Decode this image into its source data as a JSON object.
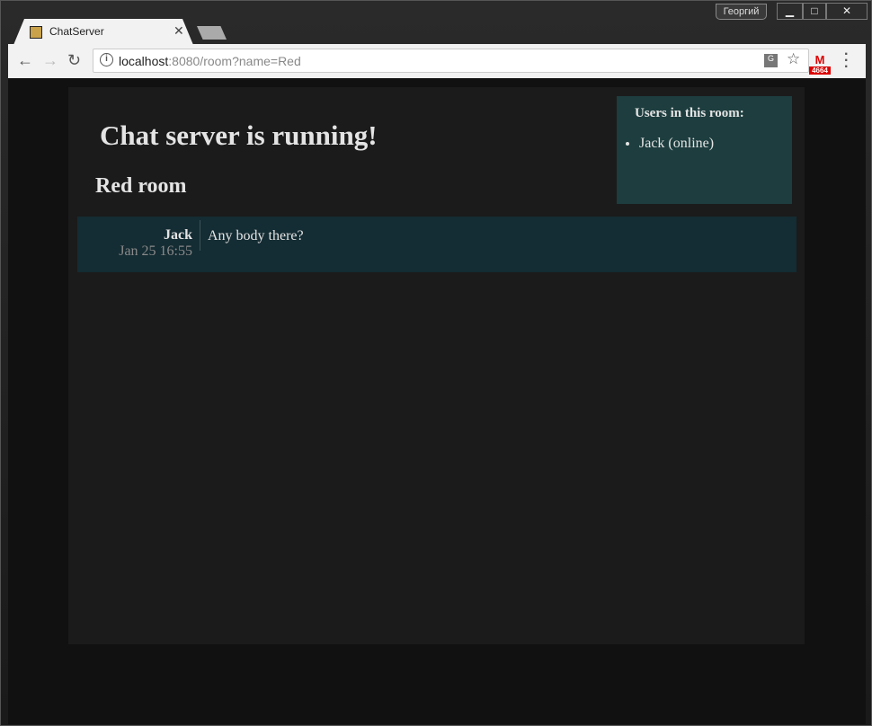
{
  "browser": {
    "tab_title": "ChatServer",
    "profile": "Георгий",
    "url_host": "localhost",
    "url_rest": ":8080/room?name=Red",
    "gmail_count": "4664"
  },
  "page": {
    "heading": "Chat server is running!",
    "room_title": "Red room",
    "users_title": "Users in this room:",
    "users": [
      "Jack (online)"
    ],
    "messages": [
      {
        "author": "Jack",
        "time": "Jan 25 16:55",
        "text": "Any body there?"
      }
    ]
  }
}
